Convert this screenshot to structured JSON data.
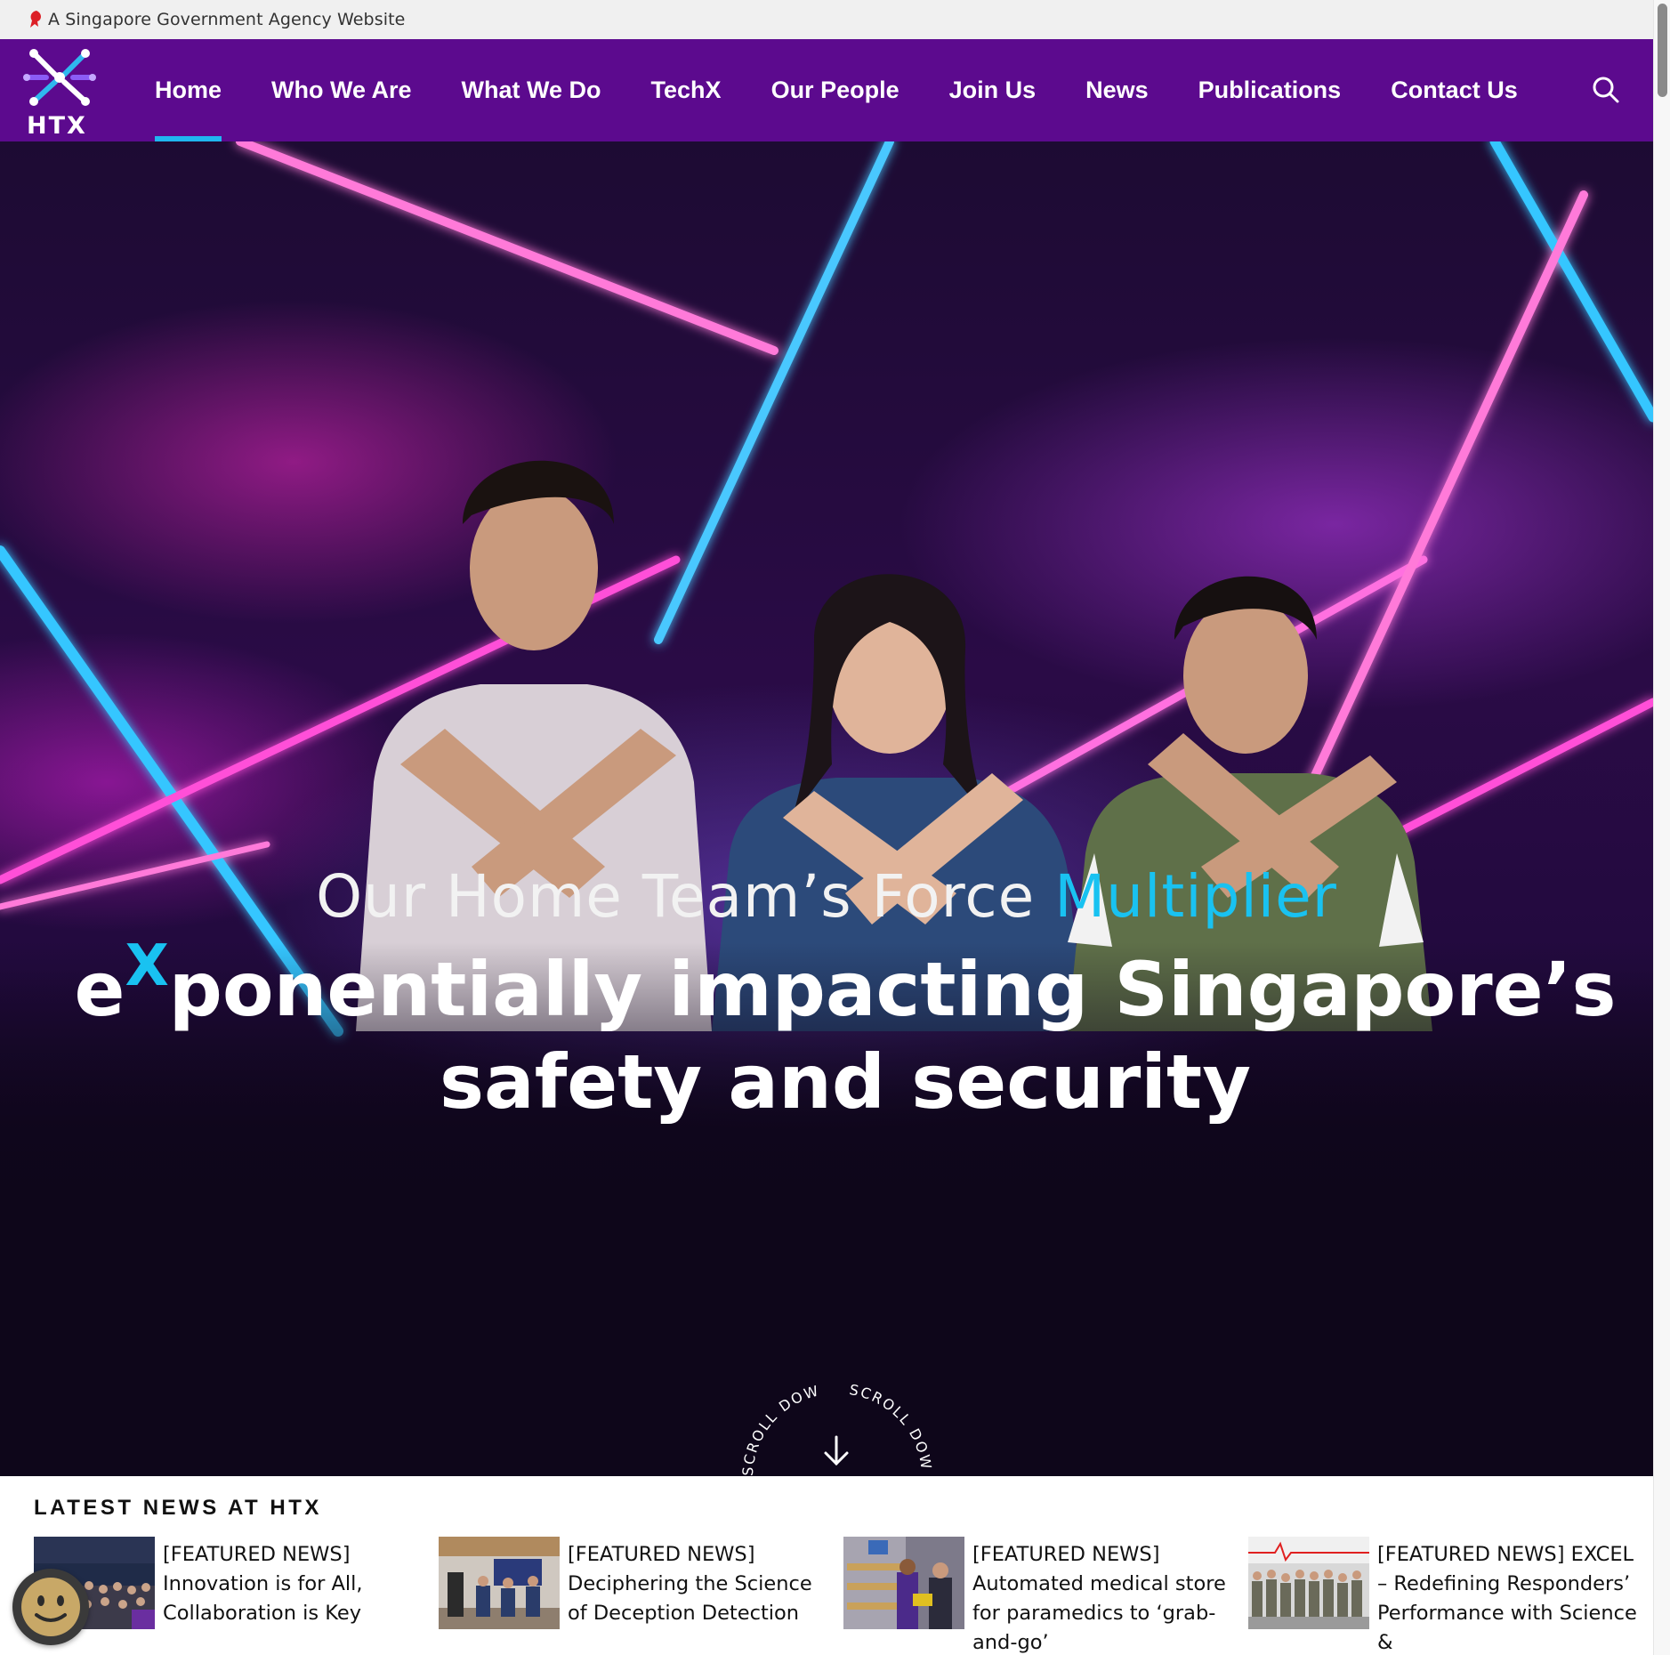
{
  "gov_banner": {
    "text": "A Singapore Government Agency Website"
  },
  "logo": {
    "text": "HTX"
  },
  "nav": {
    "items": [
      {
        "label": "Home",
        "active": true
      },
      {
        "label": "Who We Are"
      },
      {
        "label": "What We Do"
      },
      {
        "label": "TechX"
      },
      {
        "label": "Our People"
      },
      {
        "label": "Join Us"
      },
      {
        "label": "News"
      },
      {
        "label": "Publications"
      },
      {
        "label": "Contact Us"
      }
    ],
    "search_icon": "search-icon"
  },
  "hero": {
    "tagline_main": "Our Home Team’s Force ",
    "tagline_accent": "Multiplier",
    "headline_e": "e",
    "headline_x": "X",
    "headline_line1": "ponentially impacting Singapore’s",
    "headline_line2": "safety and security",
    "scroll_text": "SCROLL DOWN",
    "scroll_text_2": "SCROLL DOWN"
  },
  "news": {
    "title": "LATEST NEWS AT HTX",
    "items": [
      {
        "text": "[FEATURED NEWS] Innovation is for All, Collaboration is Key"
      },
      {
        "text": "[FEATURED NEWS] Deciphering the Science of Deception Detection"
      },
      {
        "text": "[FEATURED NEWS] Automated medical store for paramedics to ‘grab-and-go’"
      },
      {
        "text": "[FEATURED NEWS] EXCEL – Redefining Responders’ Performance with Science &"
      }
    ]
  },
  "colors": {
    "header": "#5c0a8e",
    "accent": "#20b6f0",
    "tagline_accent": "#19c2f1"
  }
}
